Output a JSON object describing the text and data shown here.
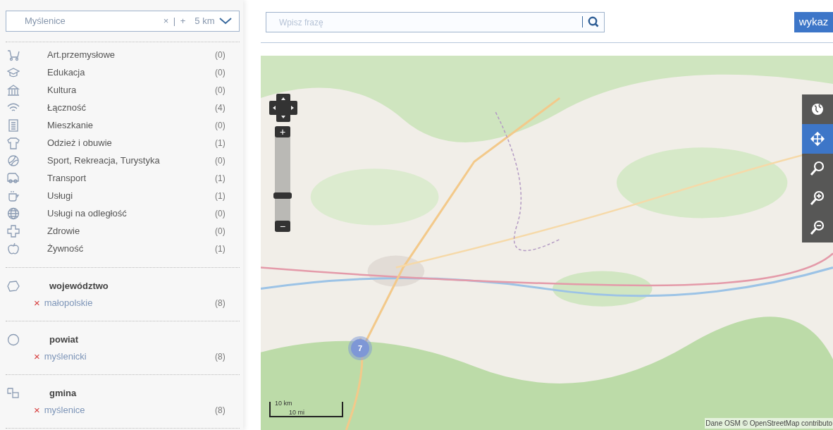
{
  "location_filter": {
    "value": "Myślenice",
    "clear": "×",
    "separator": "|",
    "add": "+",
    "radius": "5 km"
  },
  "categories": [
    {
      "label": "Art.przemysłowe",
      "count": "(0)"
    },
    {
      "label": "Edukacja",
      "count": "(0)"
    },
    {
      "label": "Kultura",
      "count": "(0)"
    },
    {
      "label": "Łączność",
      "count": "(4)"
    },
    {
      "label": "Mieszkanie",
      "count": "(0)"
    },
    {
      "label": "Odzież i obuwie",
      "count": "(1)"
    },
    {
      "label": "Sport, Rekreacja, Turystyka",
      "count": "(0)"
    },
    {
      "label": "Transport",
      "count": "(1)"
    },
    {
      "label": "Usługi",
      "count": "(1)"
    },
    {
      "label": "Usługi na odległość",
      "count": "(0)"
    },
    {
      "label": "Zdrowie",
      "count": "(0)"
    },
    {
      "label": "Żywność",
      "count": "(1)"
    }
  ],
  "regions": [
    {
      "title": "województwo",
      "item": "małopolskie",
      "remove": "×",
      "count": "(8)"
    },
    {
      "title": "powiat",
      "item": "myślenicki",
      "remove": "×",
      "count": "(8)"
    },
    {
      "title": "gmina",
      "item": "myślenice",
      "remove": "×",
      "count": "(8)"
    }
  ],
  "search": {
    "placeholder": "Wpisz frazę"
  },
  "list_button": "wykaz",
  "map": {
    "kind": "picture",
    "zoom": {
      "plus": "+",
      "minus": "−",
      "level": 0.3
    },
    "cluster": "7",
    "tools": [
      {
        "kind": "globe",
        "selected": false
      },
      {
        "kind": "pan",
        "selected": true
      },
      {
        "kind": "zoom",
        "selected": false
      },
      {
        "kind": "zoom-in",
        "selected": false
      },
      {
        "kind": "zoom-out",
        "selected": false
      }
    ],
    "scale": {
      "km": "10 km",
      "mi": "10 mi"
    },
    "attribution": "Dane OSM © OpenStreetMap contributo"
  }
}
